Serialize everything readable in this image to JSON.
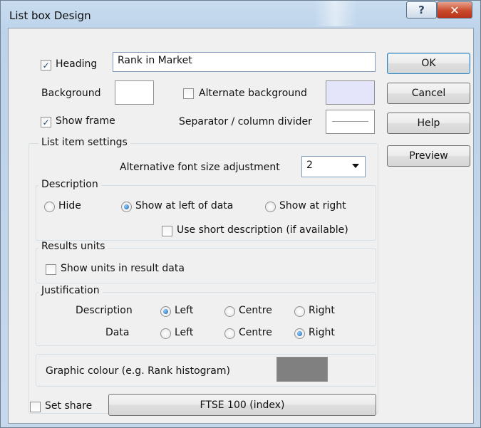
{
  "window": {
    "title": "List box Design",
    "help_glyph": "?",
    "close_glyph": "✕"
  },
  "heading": {
    "label": "Heading",
    "checked": true,
    "value": "Rank in Market"
  },
  "background": {
    "label": "Background"
  },
  "alternate_background": {
    "label": "Alternate background",
    "checked": false,
    "color": "#e4e4fb"
  },
  "show_frame": {
    "label": "Show frame",
    "checked": true
  },
  "separator": {
    "label": "Separator / column divider"
  },
  "buttons": {
    "ok": "OK",
    "cancel": "Cancel",
    "help": "Help",
    "preview": "Preview"
  },
  "list_item_settings": {
    "title": "List item settings",
    "font_adjust_label": "Alternative font size adjustment",
    "font_adjust_value": "2"
  },
  "description": {
    "title": "Description",
    "options": [
      "Hide",
      "Show at left of data",
      "Show at right"
    ],
    "selected": "Show at left of data",
    "short_desc_label": "Use short description (if available)",
    "short_desc_checked": false
  },
  "results_units": {
    "title": "Results units",
    "show_units_label": "Show units in result data",
    "checked": false
  },
  "justification": {
    "title": "Justification",
    "rows": [
      {
        "label": "Description",
        "options": [
          "Left",
          "Centre",
          "Right"
        ],
        "selected": "Left"
      },
      {
        "label": "Data",
        "options": [
          "Left",
          "Centre",
          "Right"
        ],
        "selected": "Right"
      }
    ]
  },
  "graphic_colour": {
    "label": "Graphic colour (e.g. Rank histogram)",
    "color": "#808080"
  },
  "set_share": {
    "label": "Set share",
    "checked": false,
    "button": "FTSE 100 (index)"
  },
  "icons": {
    "help": "help-icon",
    "close": "close-icon",
    "check": "checkmark-icon",
    "dropdown": "chevron-down-icon"
  }
}
